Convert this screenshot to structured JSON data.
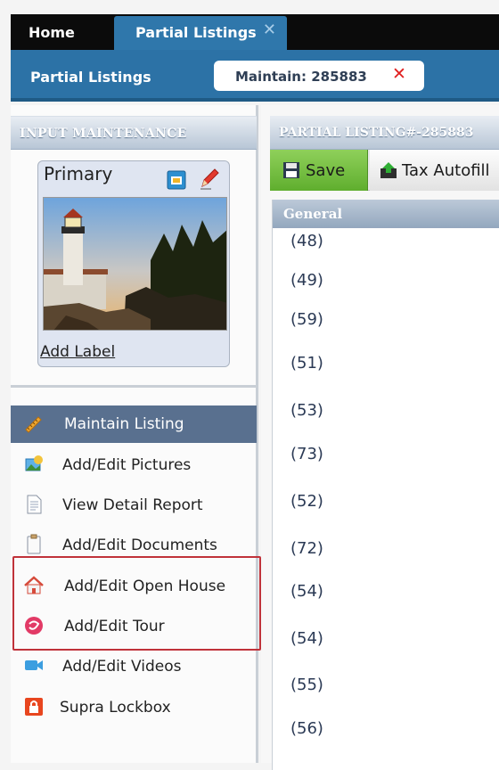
{
  "tabs": {
    "home": "Home",
    "active": "Partial Listings",
    "close_glyph": "✕"
  },
  "subbar": {
    "title": "Partial Listings",
    "maintain_pill": "Maintain: 285883",
    "close_glyph": "✕"
  },
  "left_panel": {
    "header": "INPUT MAINTENANCE",
    "photo_card": {
      "label": "Primary",
      "add_label": "Add Label",
      "icons": [
        "image-manage-icon",
        "pencil-icon"
      ]
    },
    "menu": [
      {
        "label": "Maintain Listing",
        "icon": "ruler-pencil-icon",
        "active": true
      },
      {
        "label": "Add/Edit Pictures",
        "icon": "pictures-icon",
        "active": false
      },
      {
        "label": "View Detail Report",
        "icon": "document-icon",
        "active": false
      },
      {
        "label": "Add/Edit Documents",
        "icon": "clipboard-icon",
        "active": false
      },
      {
        "label": "Add/Edit Open House",
        "icon": "house-icon",
        "active": false
      },
      {
        "label": "Add/Edit Tour",
        "icon": "tour-icon",
        "active": false
      },
      {
        "label": "Add/Edit Videos",
        "icon": "video-camera-icon",
        "active": false
      },
      {
        "label": "Supra Lockbox",
        "icon": "lockbox-icon",
        "active": false
      }
    ]
  },
  "right_panel": {
    "header": "PARTIAL LISTING#-285883",
    "toolbar": {
      "save": "Save",
      "tax_autofill": "Tax Autofill"
    },
    "section": "General",
    "codes": [
      "(48)",
      "(49)",
      "(59)",
      "(51)",
      "(53)",
      "(73)",
      "(52)",
      "(72)",
      "(54)",
      "(54)",
      "(55)",
      "(56)"
    ]
  },
  "colors": {
    "tab_bar": "#0b0b0b",
    "subbar_blue": "#2c72a6",
    "active_menu": "#59708f",
    "save_green": "#6cb93a",
    "highlight_red": "#c0323a"
  }
}
